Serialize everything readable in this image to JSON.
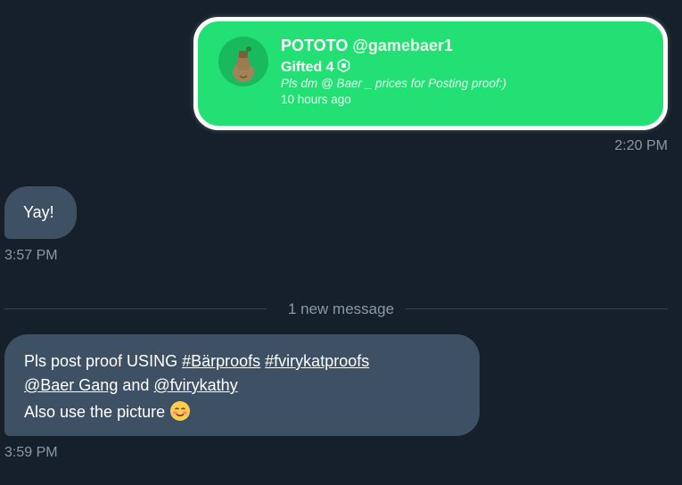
{
  "embed": {
    "name": "POTOTO",
    "handle": "@gamebaer1",
    "gifted_label": "Gifted 4",
    "currency_icon": "robux-icon",
    "message": "Pls dm @ Baer _ prices for Posting proof:)",
    "time_ago": "10 hours ago",
    "card_color": "#22e074"
  },
  "messages": [
    {
      "time": "2:20 PM"
    },
    {
      "text": "Yay!",
      "time": "3:57 PM"
    },
    {
      "line1_text": "Pls post proof USING",
      "hashtag1": "#Bärproofs",
      "hashtag2": "#fvirykatproofs",
      "mention1": "@Baer Gang",
      "connector": "and",
      "mention2": "@fvirykathy",
      "line3_text": "Also use the picture",
      "emoji": "smiling-face-icon",
      "time": "3:59 PM"
    }
  ],
  "divider": {
    "label": "1 new message"
  }
}
